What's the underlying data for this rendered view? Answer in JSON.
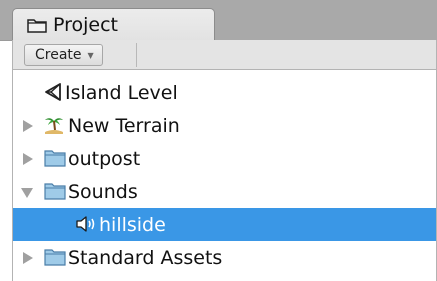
{
  "tab": {
    "label": "Project",
    "icon": "folder-icon"
  },
  "toolbar": {
    "create_label": "Create",
    "create_arrow": "▼"
  },
  "tree": {
    "items": [
      {
        "label": "Island Level",
        "icon": "unity-scene-icon",
        "expander": "none",
        "selected": false
      },
      {
        "label": "New Terrain",
        "icon": "terrain-palm-icon",
        "expander": "collapsed",
        "selected": false
      },
      {
        "label": "outpost",
        "icon": "folder-icon",
        "expander": "collapsed",
        "selected": false
      },
      {
        "label": "Sounds",
        "icon": "folder-icon",
        "expander": "expanded",
        "selected": false
      },
      {
        "label": "hillside",
        "icon": "audio-clip-icon",
        "expander": "none",
        "selected": true
      },
      {
        "label": "Standard Assets",
        "icon": "folder-icon",
        "expander": "collapsed",
        "selected": false
      }
    ]
  },
  "colors": {
    "selection": "#3a97e6",
    "tabbar_bg": "#a9a9a9",
    "folder_fill": "#9fcbe8"
  }
}
